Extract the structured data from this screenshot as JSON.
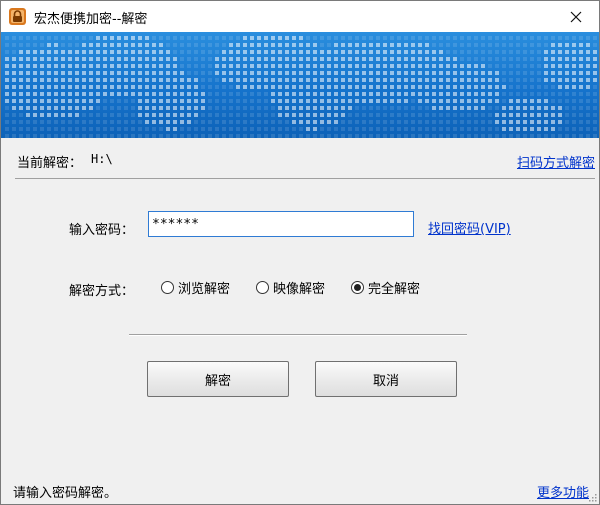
{
  "window": {
    "title": "宏杰便携加密--解密",
    "close_glyph": "✕"
  },
  "colors": {
    "banner_top": "#2a8ede",
    "banner_bottom": "#0d62b8",
    "link": "#0033cc",
    "input_border": "#2f7bd4",
    "app_icon": "#d9781e"
  },
  "current": {
    "label": "当前解密：",
    "value": "H:\\"
  },
  "links": {
    "qr_decrypt": "扫码方式解密",
    "recover_password": "找回密码(VIP)",
    "more_features": "更多功能"
  },
  "password": {
    "label": "输入密码：",
    "value": "******"
  },
  "mode": {
    "label": "解密方式：",
    "options": [
      {
        "label": "浏览解密",
        "selected": false
      },
      {
        "label": "映像解密",
        "selected": false
      },
      {
        "label": "完全解密",
        "selected": true
      }
    ]
  },
  "buttons": {
    "decrypt": "解密",
    "cancel": "取消"
  },
  "status": {
    "text": "请输入密码解密。"
  },
  "icons": {
    "app": "lock-icon",
    "close": "close-icon"
  }
}
